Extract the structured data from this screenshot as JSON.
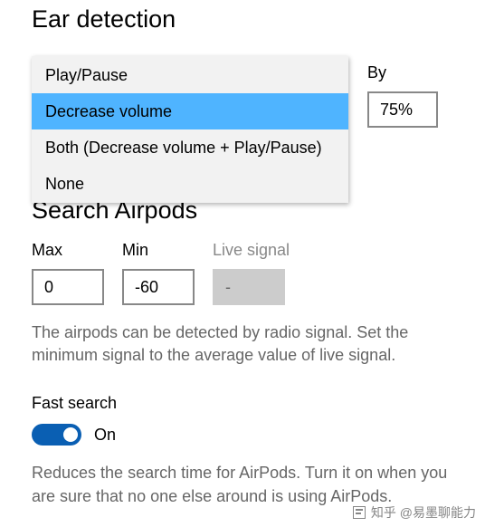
{
  "earDetection": {
    "title": "Ear detection",
    "dropdown": {
      "items": [
        {
          "label": "Play/Pause",
          "selected": false
        },
        {
          "label": "Decrease volume",
          "selected": true
        },
        {
          "label": "Both (Decrease volume + Play/Pause)",
          "selected": false
        },
        {
          "label": "None",
          "selected": false
        }
      ]
    },
    "byLabel": "By",
    "byValue": "75%"
  },
  "searchAirpods": {
    "title": "Search Airpods",
    "maxLabel": "Max",
    "maxValue": "0",
    "minLabel": "Min",
    "minValue": "-60",
    "liveSignalLabel": "Live signal",
    "liveSignalValue": "-",
    "description": "The airpods can be detected by radio signal.  Set the minimum signal to the average value of live signal."
  },
  "fastSearch": {
    "label": "Fast search",
    "state": "On",
    "description": "Reduces the search time for AirPods. Turn it on when you are sure that no one else around is using AirPods."
  },
  "watermark": "知乎 @易墨聊能力"
}
